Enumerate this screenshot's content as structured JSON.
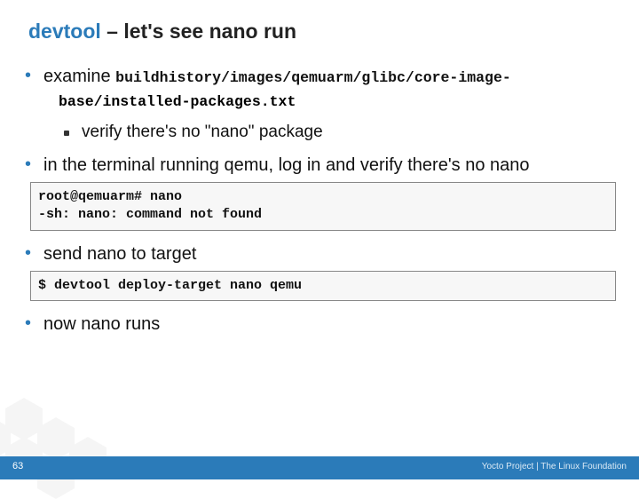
{
  "title": {
    "blue": "devtool",
    "dash": " – ",
    "rest": "let's see nano run"
  },
  "bullets": {
    "b1_prefix": "examine ",
    "b1_path1": "buildhistory/images/qemuarm/glibc/core-image-",
    "b1_path2": "base/installed-packages.txt",
    "b1_sub": "verify there's no \"nano\" package",
    "b2": "in the terminal running qemu, log in and verify there's no nano",
    "code1": "root@qemuarm# nano\n-sh: nano: command not found",
    "b3": "send nano to target",
    "code2": "$ devtool deploy-target nano qemu",
    "b4": "now nano runs"
  },
  "footer": {
    "page": "63",
    "credit": "Yocto Project | The Linux Foundation"
  }
}
